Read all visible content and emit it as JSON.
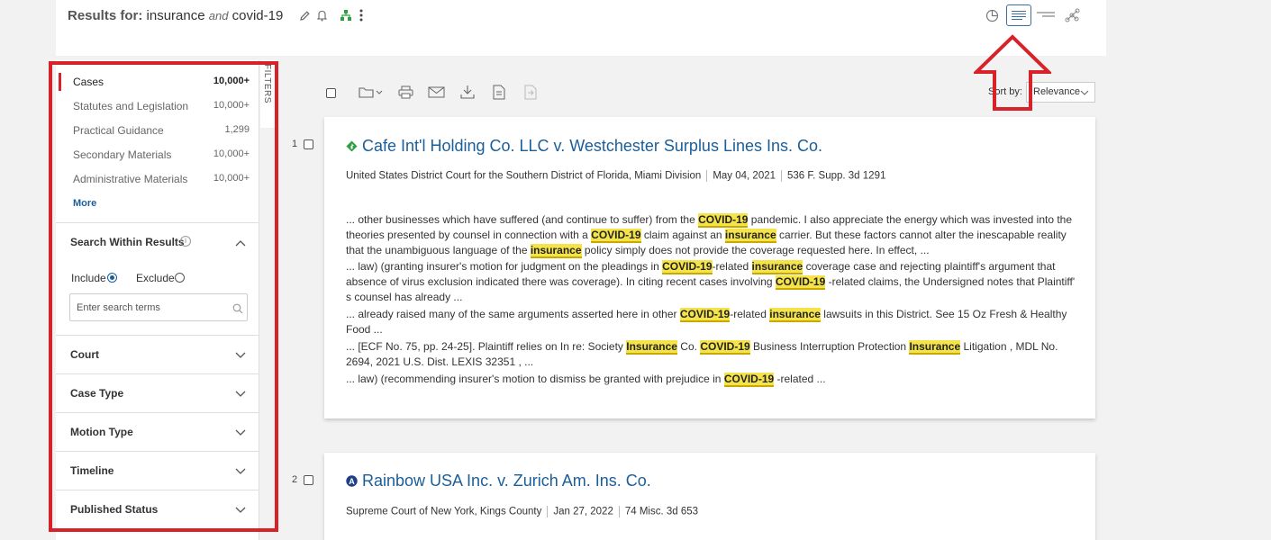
{
  "header": {
    "results_label": "Results for:",
    "query_term1": "insurance",
    "query_and": "and",
    "query_term2": "covid-19"
  },
  "sidebar": {
    "categories": [
      {
        "label": "Cases",
        "count": "10,000+"
      },
      {
        "label": "Statutes and Legislation",
        "count": "10,000+"
      },
      {
        "label": "Practical Guidance",
        "count": "1,299"
      },
      {
        "label": "Secondary Materials",
        "count": "10,000+"
      },
      {
        "label": "Administrative Materials",
        "count": "10,000+"
      }
    ],
    "more_label": "More",
    "filters_tab_label": "FILTERS",
    "search_within": {
      "title": "Search Within Results",
      "include_label": "Include",
      "exclude_label": "Exclude",
      "placeholder": "Enter search terms"
    },
    "accordions": [
      "Court",
      "Case Type",
      "Motion Type",
      "Timeline",
      "Published Status"
    ]
  },
  "toolbar": {
    "sort_label": "Sort by:",
    "sort_value": "Relevance"
  },
  "results": [
    {
      "number": "1",
      "title": "Cafe Int'l Holding Co. LLC v. Westchester Surplus Lines Ins. Co.",
      "court": "United States District Court for the Southern District of Florida, Miami Division",
      "date": "May 04, 2021",
      "citation": "536 F. Supp. 3d 1291",
      "snippets": [
        [
          {
            "t": "... other businesses which have suffered (and continue to suffer) from the "
          },
          {
            "t": "COVID-19",
            "h": true
          },
          {
            "t": " pandemic. I also appreciate the energy which was invested into the theories presented by counsel in connection with a "
          },
          {
            "t": "COVID-19",
            "h": true
          },
          {
            "t": " claim against an "
          },
          {
            "t": "insurance",
            "h": true
          },
          {
            "t": " carrier. But these factors cannot alter the inescapable reality that the unambiguous language of the "
          },
          {
            "t": "insurance",
            "h": true
          },
          {
            "t": " policy simply does not provide the coverage requested here. In effect, ..."
          }
        ],
        [
          {
            "t": "... law) (granting insurer's motion for judgment on the pleadings in "
          },
          {
            "t": "COVID-19",
            "h": true
          },
          {
            "t": "-related "
          },
          {
            "t": "insurance",
            "h": true
          },
          {
            "t": " coverage case and rejecting plaintiff's argument that absence of virus exclusion indicated there was coverage). In citing recent cases involving "
          },
          {
            "t": "COVID-19",
            "h": true
          },
          {
            "t": " -related claims, the Undersigned notes that Plaintiff' s counsel has already ..."
          }
        ],
        [
          {
            "t": "... already raised many of the same arguments asserted here in other "
          },
          {
            "t": "COVID-19",
            "h": true
          },
          {
            "t": "-related "
          },
          {
            "t": "insurance",
            "h": true
          },
          {
            "t": " lawsuits in this District. See 15 Oz Fresh & Healthy Food ..."
          }
        ],
        [
          {
            "t": "... [ECF No. 75, pp. 24-25]. Plaintiff relies on In re: Society "
          },
          {
            "t": "Insurance",
            "h": true
          },
          {
            "t": " Co. "
          },
          {
            "t": "COVID-19",
            "h": true
          },
          {
            "t": " Business Interruption Protection "
          },
          {
            "t": "Insurance",
            "h": true
          },
          {
            "t": " Litigation , MDL No. 2694, 2021 U.S. Dist. LEXIS 32351 , ..."
          }
        ],
        [
          {
            "t": "... law) (recommending insurer's motion to dismiss be granted with prejudice in "
          },
          {
            "t": "COVID-19",
            "h": true
          },
          {
            "t": " -related ..."
          }
        ]
      ]
    },
    {
      "number": "2",
      "title": "Rainbow USA Inc. v. Zurich Am. Ins. Co.",
      "court": "Supreme Court of New York, Kings County",
      "date": "Jan 27, 2022",
      "citation": "74 Misc. 3d 653"
    }
  ],
  "colors": {
    "link_blue": "#1a5e9a",
    "highlight": "#f5e34a",
    "annotation_red": "#d8222a",
    "badge_green": "#2e9e3f"
  },
  "icons": [
    "edit-icon",
    "bell-icon",
    "hierarchy-icon",
    "more-vertical-icon",
    "pie-chart-icon",
    "list-view-icon",
    "title-view-icon",
    "graph-view-icon",
    "folder-icon",
    "print-icon",
    "email-icon",
    "download-icon",
    "copy-icon",
    "export-icon",
    "search-icon",
    "info-icon",
    "chevron-up-icon",
    "chevron-down-icon",
    "signal-green-icon",
    "signal-blue-a-icon"
  ]
}
